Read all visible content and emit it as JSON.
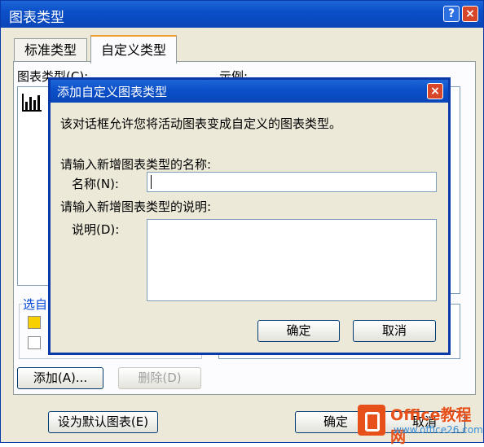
{
  "window": {
    "title": "图表类型",
    "help_button": "?",
    "close_button": "×"
  },
  "tabs": [
    {
      "label": "标准类型"
    },
    {
      "label": "自定义类型"
    }
  ],
  "labels": {
    "chart_type": "图表类型(C):",
    "sample": "示例:",
    "group": "选自"
  },
  "buttons": {
    "add": "添加(A)...",
    "delete": "删除(D)",
    "set_default": "设为默认图表(E)",
    "ok": "确定",
    "cancel": "取消"
  },
  "dialog": {
    "title": "添加自定义图表类型",
    "close": "×",
    "description": "该对话框允许您将活动图表变成自定义的图表类型。",
    "name_prompt": "请输入新增图表类型的名称:",
    "name_label": "名称(N):",
    "name_value": "",
    "desc_prompt": "请输入新增图表类型的说明:",
    "desc_label": "说明(D):",
    "desc_value": "",
    "ok": "确定",
    "cancel": "取消"
  },
  "watermark": {
    "brand": "Office教程网",
    "url": "www.office26.com"
  },
  "colors": {
    "title_bar": "#0b4fc8",
    "close": "#d8462a",
    "radio_yellow": "#f8d000",
    "watermark": "#e8501a"
  }
}
